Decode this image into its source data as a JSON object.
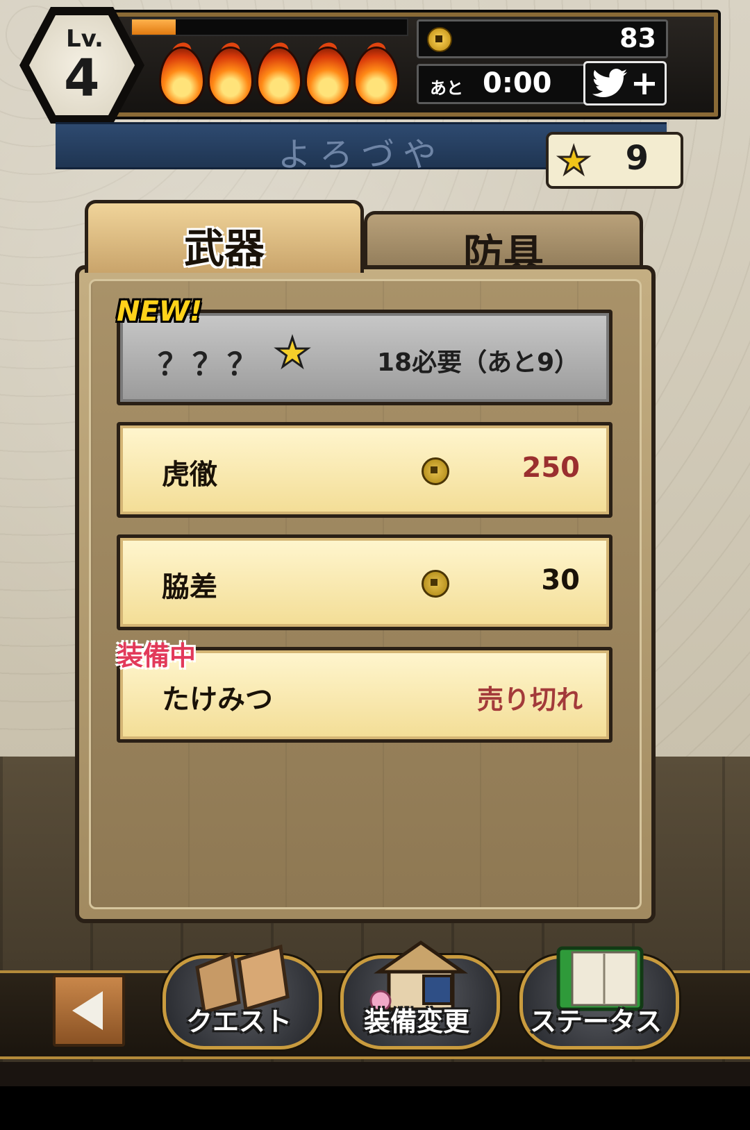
{
  "hud": {
    "level_label": "Lv.",
    "level": "4",
    "exp_progress": 0.16,
    "stamina_flames": 5,
    "coins": "83",
    "timer_prefix": "あと",
    "timer": "0:00",
    "share_icon": "twitter-bird-icon",
    "share_plus": "+"
  },
  "banner": {
    "title": "よろづや"
  },
  "stars": {
    "icon": "star-icon",
    "count": "9"
  },
  "tabs": [
    {
      "label": "武器",
      "active": true
    },
    {
      "label": "防具",
      "active": false
    }
  ],
  "items": [
    {
      "badge": "NEW!",
      "name": "？？？",
      "requirement": "18必要（あと9）",
      "state": "locked"
    },
    {
      "name": "虎徹",
      "price": "250",
      "price_color": "#9a2f2f",
      "state": "buy"
    },
    {
      "name": "脇差",
      "price": "30",
      "price_color": "#1a1208",
      "state": "buy"
    },
    {
      "badge": "装備中",
      "name": "たけみつ",
      "status": "売り切れ",
      "state": "equipped"
    }
  ],
  "nav": {
    "back_icon": "back-arrow-icon",
    "buttons": [
      {
        "label": "クエスト",
        "icon": "quest-boards-icon"
      },
      {
        "label": "装備変更",
        "icon": "house-icon"
      },
      {
        "label": "ステータス",
        "icon": "book-icon"
      }
    ]
  }
}
